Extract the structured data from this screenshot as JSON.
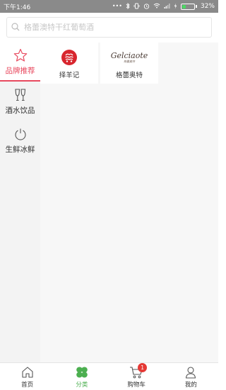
{
  "status_bar": {
    "time": "下午1:46",
    "icons": [
      "dots-icon",
      "bluetooth-icon",
      "vibrate-icon",
      "alarm-icon",
      "wifi-icon",
      "signal-icon",
      "charging-icon"
    ],
    "battery_percent": "32%",
    "battery_level": 0.32
  },
  "search": {
    "placeholder": "格蕾澳特干红葡萄酒"
  },
  "sidebar": {
    "items": [
      {
        "label": "品牌推荐",
        "icon": "star-icon",
        "active": true
      },
      {
        "label": "酒水饮品",
        "icon": "wine-glasses-icon",
        "active": false
      },
      {
        "label": "生鲜冰鲜",
        "icon": "power-icon",
        "active": false
      }
    ]
  },
  "brands": [
    {
      "name": "择羊记",
      "logo": "zeyangji-logo"
    },
    {
      "name": "格蕾奥特",
      "logo": "gelciaote-logo",
      "logo_text": "Gelciaote",
      "logo_subtext": "格蕾奥特"
    }
  ],
  "tabbar": {
    "items": [
      {
        "label": "首页",
        "icon": "home-icon",
        "active": false
      },
      {
        "label": "分类",
        "icon": "category-icon",
        "active": true
      },
      {
        "label": "购物车",
        "icon": "cart-icon",
        "active": false,
        "badge": "1"
      },
      {
        "label": "我的",
        "icon": "user-icon",
        "active": false
      }
    ]
  },
  "colors": {
    "accent_red": "#e84a5f",
    "active_green": "#4caf50",
    "badge_red": "#e53935"
  }
}
